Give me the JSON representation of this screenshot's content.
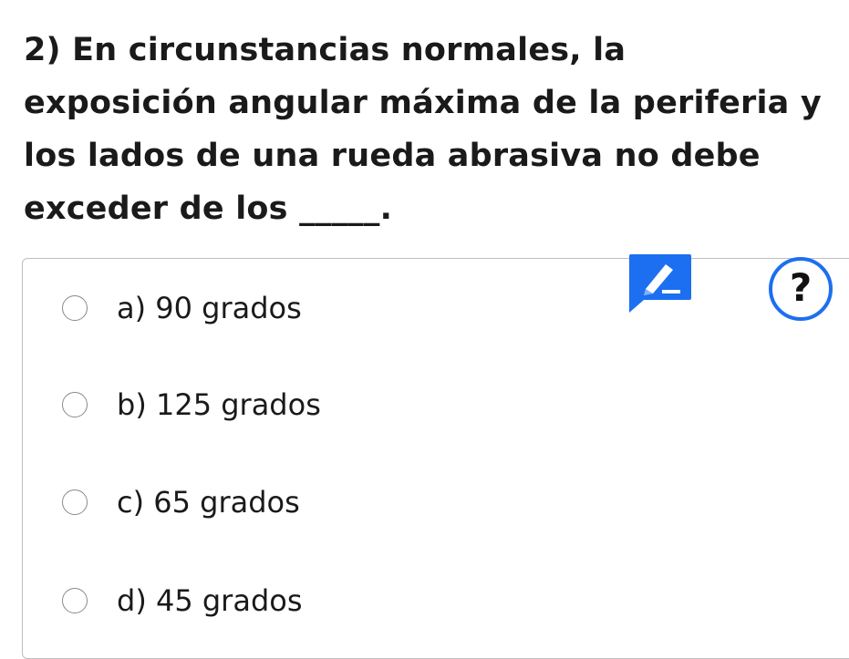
{
  "question": {
    "text": "2) En circunstancias normales, la exposición angular máxima de la periferia y los lados de una rueda abrasiva no debe exceder de los _____."
  },
  "options": [
    {
      "label": "a) 90 grados"
    },
    {
      "label": "b) 125 grados"
    },
    {
      "label": "c) 65 grados"
    },
    {
      "label": "d) 45 grados"
    }
  ],
  "icons": {
    "notepad": "pencil-notepad-icon",
    "help": "help-question-icon",
    "help_glyph": "?"
  },
  "colors": {
    "accent": "#1c6ff0",
    "text": "#1a1a1a",
    "border": "#bfbfbf"
  }
}
